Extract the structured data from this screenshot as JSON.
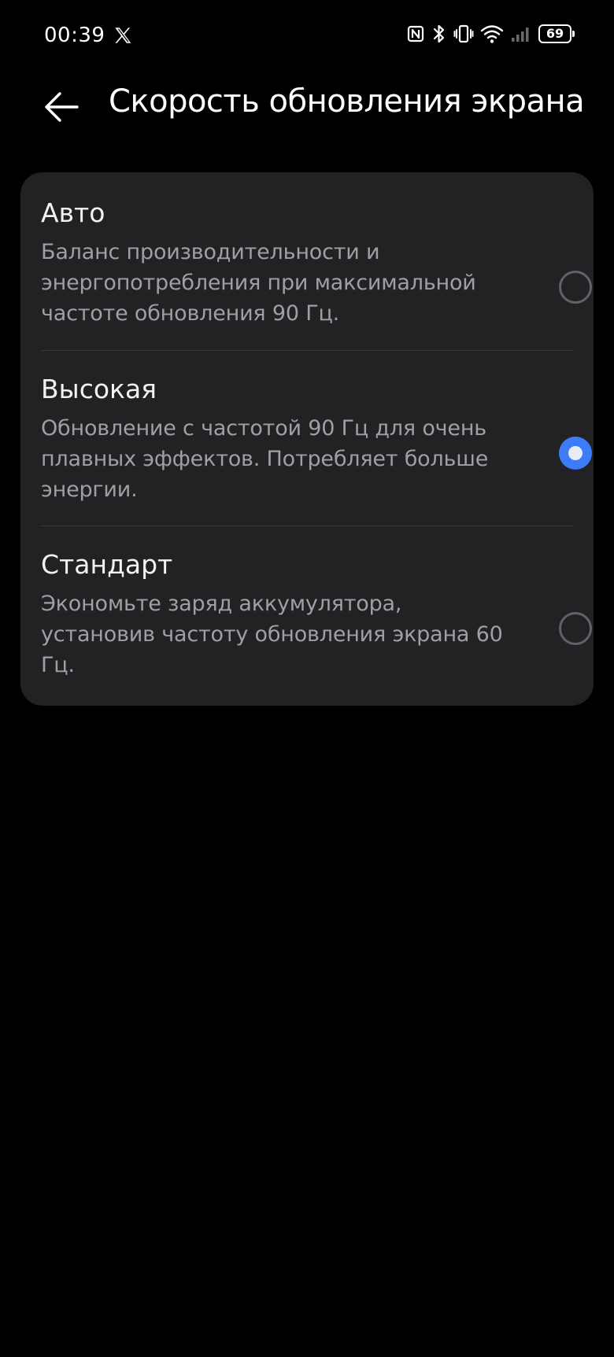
{
  "status_bar": {
    "time": "00:39",
    "battery_level": "69",
    "icons": [
      "x-app-icon",
      "nfc-icon",
      "bluetooth-icon",
      "vibrate-icon",
      "wifi-icon",
      "signal-icon",
      "battery-icon"
    ]
  },
  "header": {
    "back_icon": "arrow-left-icon",
    "title": "Скорость обновления экрана"
  },
  "options": [
    {
      "title": "Авто",
      "description": "Баланс производительности и энергопотребления при максимальной частоте обновления 90 Гц.",
      "selected": false
    },
    {
      "title": "Высокая",
      "description": "Обновление с частотой 90 Гц для очень плавных эффектов. Потребляет больше энергии.",
      "selected": true
    },
    {
      "title": "Стандарт",
      "description": "Экономьте заряд аккумулятора, установив частоту обновления экрана 60 Гц.",
      "selected": false
    }
  ],
  "colors": {
    "background": "#000000",
    "card": "#222224",
    "accent": "#3d7bf7",
    "secondary_text": "#a0a0a4"
  }
}
